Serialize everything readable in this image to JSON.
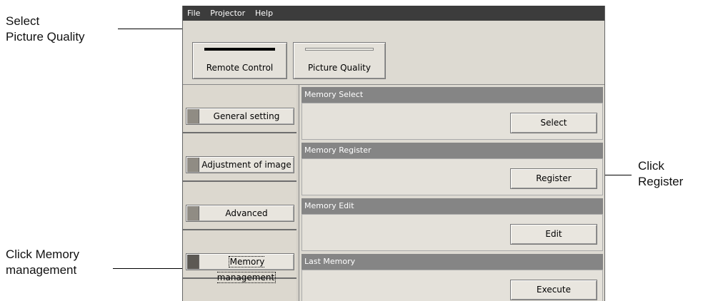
{
  "callouts": {
    "picture_quality": {
      "line1": "Select",
      "line2": "Picture Quality"
    },
    "memory": {
      "line1_prefix": "Click ",
      "line1_strong": "Memory",
      "line2": "management"
    },
    "register": {
      "line1": "Click",
      "line2": "Register"
    }
  },
  "menu": [
    "File",
    "Projector",
    "Help"
  ],
  "toolbar": {
    "remote_control": "Remote Control",
    "picture_quality": "Picture Quality"
  },
  "sidebar": {
    "items": [
      {
        "label": "General setting"
      },
      {
        "label": "Adjustment of image"
      },
      {
        "label": "Advanced"
      },
      {
        "label": "Memory management"
      }
    ]
  },
  "panels": [
    {
      "title": "Memory Select",
      "button": "Select"
    },
    {
      "title": "Memory Register",
      "button": "Register"
    },
    {
      "title": "Memory Edit",
      "button": "Edit"
    },
    {
      "title": "Last Memory",
      "button": "Execute"
    }
  ],
  "colors": {
    "menubar": "#3c3c3c",
    "panel_header": "#858585",
    "window_bg": "#d4d0c8"
  }
}
